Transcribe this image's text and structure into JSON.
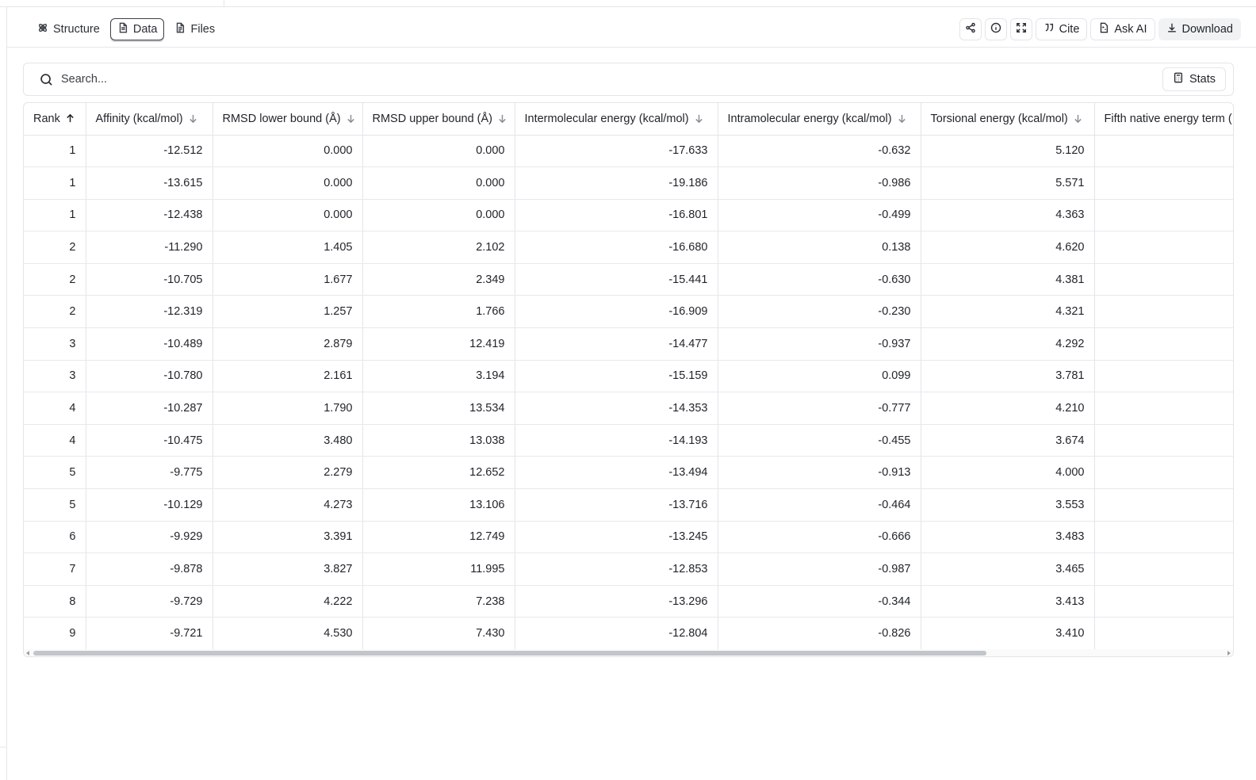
{
  "tabs": [
    {
      "label": "Structure",
      "icon": "atom-icon",
      "active": false
    },
    {
      "label": "Data",
      "icon": "file-icon",
      "active": true
    },
    {
      "label": "Files",
      "icon": "file-text-icon",
      "active": false
    }
  ],
  "actions": {
    "cite_label": "Cite",
    "ask_ai_label": "Ask AI",
    "download_label": "Download"
  },
  "search": {
    "placeholder": "Search...",
    "stats_label": "Stats"
  },
  "table": {
    "columns": [
      {
        "label": "Rank",
        "sort": "asc"
      },
      {
        "label": "Affinity (kcal/mol)",
        "sort": "none"
      },
      {
        "label": "RMSD lower bound (Å)",
        "sort": "none"
      },
      {
        "label": "RMSD upper bound (Å)",
        "sort": "none"
      },
      {
        "label": "Intermolecular energy (kcal/mol)",
        "sort": "none"
      },
      {
        "label": "Intramolecular energy (kcal/mol)",
        "sort": "none"
      },
      {
        "label": "Torsional energy (kcal/mol)",
        "sort": "none"
      },
      {
        "label": "Fifth native energy term (",
        "sort": "none"
      }
    ],
    "rows": [
      [
        "1",
        "-12.512",
        "0.000",
        "0.000",
        "-17.633",
        "-0.632",
        "5.120",
        ""
      ],
      [
        "1",
        "-13.615",
        "0.000",
        "0.000",
        "-19.186",
        "-0.986",
        "5.571",
        ""
      ],
      [
        "1",
        "-12.438",
        "0.000",
        "0.000",
        "-16.801",
        "-0.499",
        "4.363",
        ""
      ],
      [
        "2",
        "-11.290",
        "1.405",
        "2.102",
        "-16.680",
        "0.138",
        "4.620",
        ""
      ],
      [
        "2",
        "-10.705",
        "1.677",
        "2.349",
        "-15.441",
        "-0.630",
        "4.381",
        ""
      ],
      [
        "2",
        "-12.319",
        "1.257",
        "1.766",
        "-16.909",
        "-0.230",
        "4.321",
        ""
      ],
      [
        "3",
        "-10.489",
        "2.879",
        "12.419",
        "-14.477",
        "-0.937",
        "4.292",
        ""
      ],
      [
        "3",
        "-10.780",
        "2.161",
        "3.194",
        "-15.159",
        "0.099",
        "3.781",
        ""
      ],
      [
        "4",
        "-10.287",
        "1.790",
        "13.534",
        "-14.353",
        "-0.777",
        "4.210",
        ""
      ],
      [
        "4",
        "-10.475",
        "3.480",
        "13.038",
        "-14.193",
        "-0.455",
        "3.674",
        ""
      ],
      [
        "5",
        "-9.775",
        "2.279",
        "12.652",
        "-13.494",
        "-0.913",
        "4.000",
        ""
      ],
      [
        "5",
        "-10.129",
        "4.273",
        "13.106",
        "-13.716",
        "-0.464",
        "3.553",
        ""
      ],
      [
        "6",
        "-9.929",
        "3.391",
        "12.749",
        "-13.245",
        "-0.666",
        "3.483",
        ""
      ],
      [
        "7",
        "-9.878",
        "3.827",
        "11.995",
        "-12.853",
        "-0.987",
        "3.465",
        ""
      ],
      [
        "8",
        "-9.729",
        "4.222",
        "7.238",
        "-13.296",
        "-0.344",
        "3.413",
        ""
      ],
      [
        "9",
        "-9.721",
        "4.530",
        "7.430",
        "-12.804",
        "-0.826",
        "3.410",
        ""
      ]
    ]
  }
}
